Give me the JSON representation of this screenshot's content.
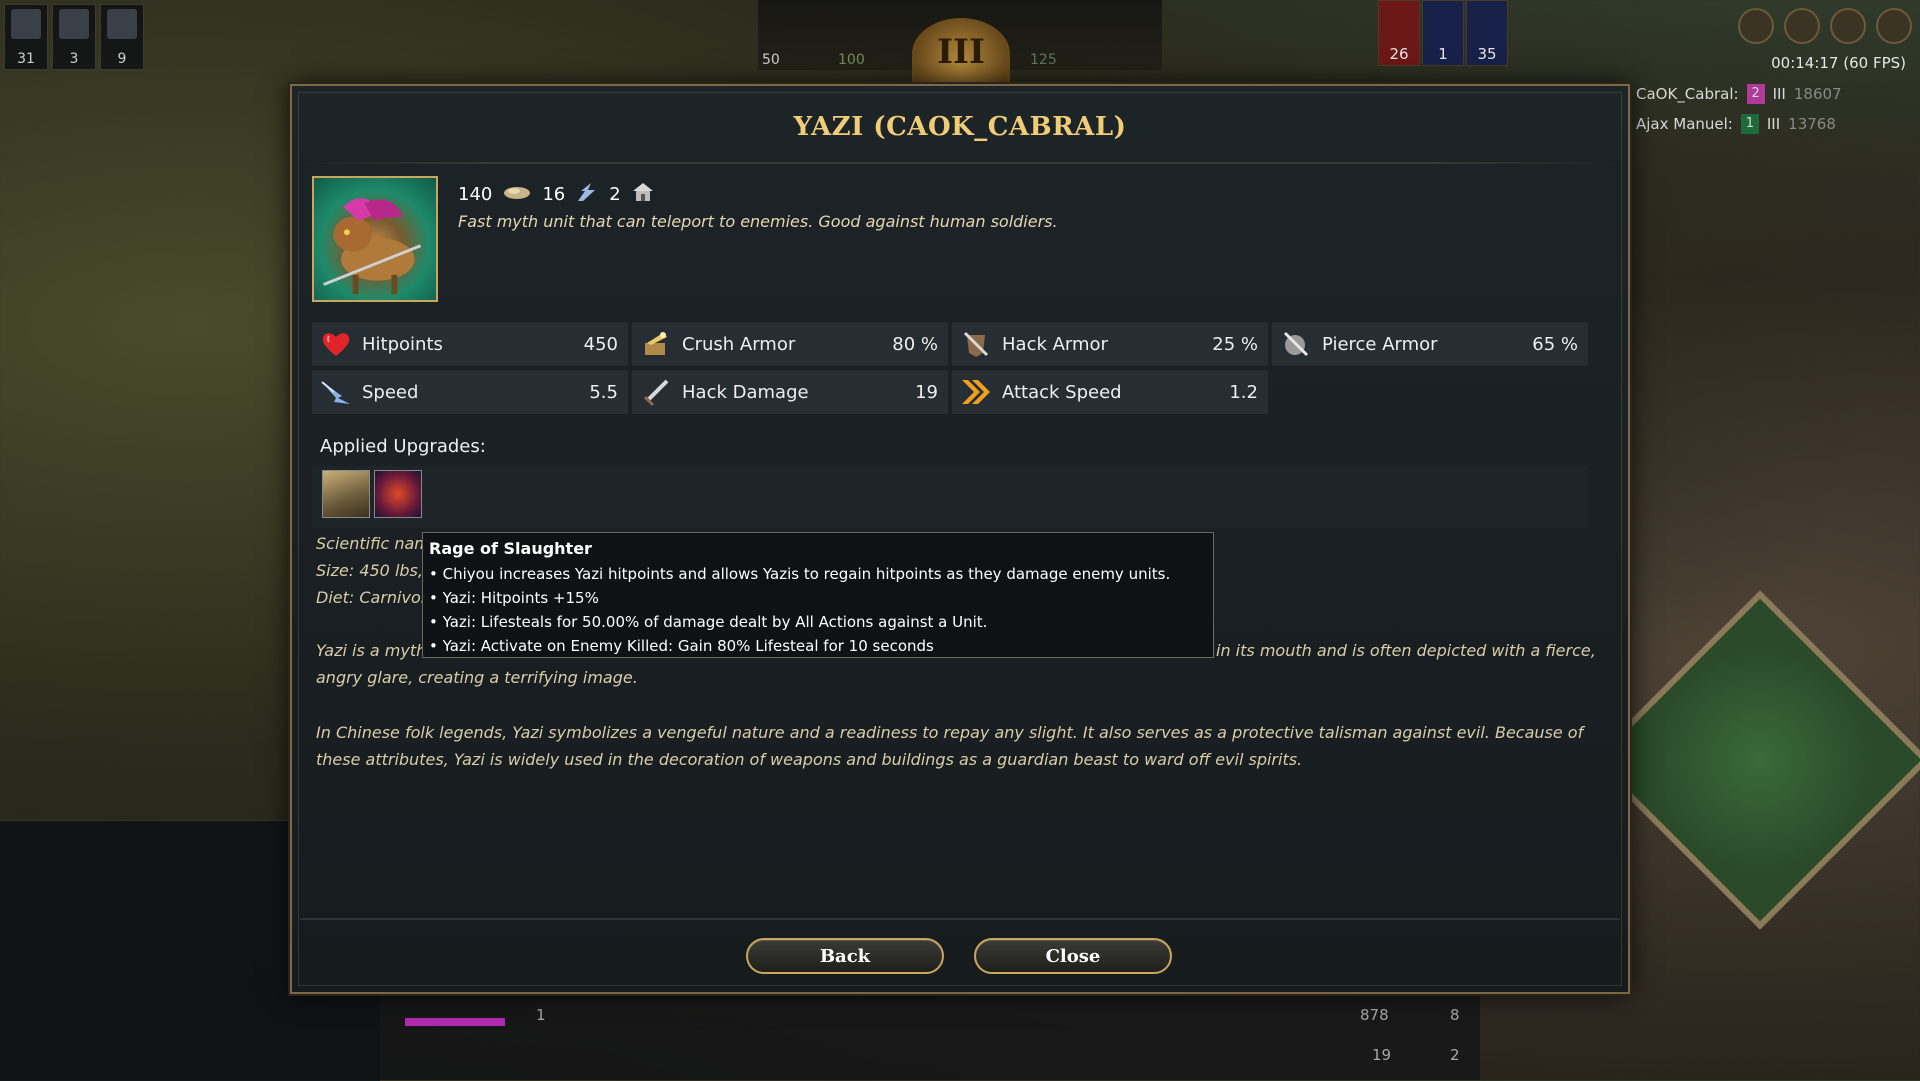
{
  "hud": {
    "left_counts": [
      "31",
      "3",
      "9"
    ],
    "center_counts": [
      "50",
      "100",
      "125"
    ],
    "age": "III",
    "stat_counts": [
      "26",
      "1",
      "35"
    ],
    "timer": "00:14:17 (60 FPS)",
    "players": [
      {
        "name": "CaOK_Cabral:",
        "team": "2",
        "age": "III",
        "score": "18607",
        "color": "#b03a9a"
      },
      {
        "name": "Ajax Manuel:",
        "team": "1",
        "age": "III",
        "score": "13768",
        "color": "#1e6a3a"
      }
    ],
    "bottom_counts": [
      "1",
      "878",
      "8",
      "19",
      "2"
    ]
  },
  "dialog": {
    "title": "YAZI (CAOK_CABRAL)",
    "cost_food": "140",
    "cost_favor": "16",
    "cost_pop": "2",
    "description": "Fast myth unit that can teleport to enemies. Good against human soldiers.",
    "stats": [
      {
        "label": "Hitpoints",
        "value": "450",
        "icon": "heart-icon"
      },
      {
        "label": "Crush Armor",
        "value": "80 %",
        "icon": "crush-armor-icon"
      },
      {
        "label": "Hack Armor",
        "value": "25 %",
        "icon": "hack-armor-icon"
      },
      {
        "label": "Pierce Armor",
        "value": "65 %",
        "icon": "pierce-armor-icon"
      },
      {
        "label": "Speed",
        "value": "5.5",
        "icon": "speed-icon"
      },
      {
        "label": "Hack Damage",
        "value": "19",
        "icon": "hack-damage-icon"
      },
      {
        "label": "Attack Speed",
        "value": "1.2",
        "icon": "attack-speed-icon"
      }
    ],
    "upgrades_label": "Applied Upgrades:",
    "sci_lines": [
      "Scientific nam",
      "Size: 450 lbs,",
      "Diet: Carnivor"
    ],
    "lore_1_start": "Yazi is a myth",
    "lore_1_end": "in its mouth and is often depicted with a fierce,",
    "lore_1_line2": "angry glare, creating a terrifying image.",
    "lore_2": "In Chinese folk legends, Yazi symbolizes a vengeful nature and a readiness to repay any slight. It also serves as a protective talisman against evil. Because of these attributes, Yazi is widely used in the decoration of weapons and buildings as a guardian beast to ward off evil spirits.",
    "back_label": "Back",
    "close_label": "Close"
  },
  "tooltip": {
    "title": "Rage of Slaughter",
    "lines": [
      "• Chiyou increases Yazi hitpoints and allows Yazis to regain hitpoints as they damage enemy units.",
      "• Yazi: Hitpoints +15%",
      "• Yazi: Lifesteals for 50.00% of damage dealt by All Actions against a Unit.",
      "• Yazi: Activate on Enemy Killed: Gain 80% Lifesteal for 10 seconds"
    ]
  }
}
